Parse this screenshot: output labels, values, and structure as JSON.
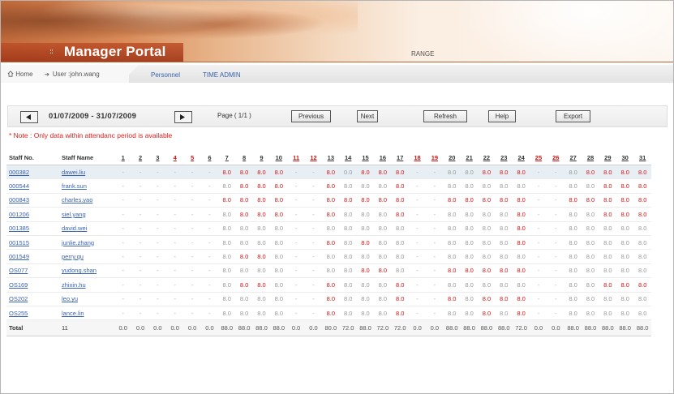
{
  "header": {
    "title": "Manager Portal",
    "range_label": "RANGE",
    "dots": "::"
  },
  "nav": {
    "home": "Home",
    "user": "User :john.wang",
    "links": [
      "Personnel",
      "TIME ADMIN"
    ]
  },
  "toolbar": {
    "prev_arrow": "◄",
    "next_arrow": "►",
    "date_range": "01/07/2009 - 31/07/2009",
    "page_info": "Page ( 1/1 )",
    "buttons": [
      "Previous",
      "Next",
      "Refresh",
      "Help",
      "Export"
    ]
  },
  "note": "* Note : Only data within attendanc period is available",
  "table": {
    "col_staff_no": "Staff No.",
    "col_staff_name": "Staff Name",
    "days": [
      "1",
      "2",
      "3",
      "4",
      "5",
      "6",
      "7",
      "8",
      "9",
      "10",
      "11",
      "12",
      "13",
      "14",
      "15",
      "16",
      "17",
      "18",
      "19",
      "20",
      "21",
      "22",
      "23",
      "24",
      "25",
      "26",
      "27",
      "28",
      "29",
      "30",
      "31"
    ],
    "weekend_days": [
      4,
      5,
      11,
      12,
      18,
      19,
      25,
      26
    ],
    "rows": [
      {
        "no": "000382",
        "name": "dawei.liu",
        "cells": [
          "-",
          "-",
          "-",
          "-",
          "-",
          "-",
          "8.0r",
          "8.0r",
          "8.0r",
          "8.0r",
          "-",
          "-",
          "8.0r",
          "0.0",
          "8.0r",
          "8.0r",
          "8.0r",
          "-",
          "-",
          "8.0",
          "8.0",
          "8.0r",
          "8.0r",
          "8.0r",
          "-",
          "-",
          "8.0",
          "8.0r",
          "8.0r",
          "8.0r",
          "8.0r"
        ]
      },
      {
        "no": "000544",
        "name": "frank.sun",
        "cells": [
          "-",
          "-",
          "-",
          "-",
          "-",
          "-",
          "8.0",
          "8.0r",
          "8.0r",
          "8.0r",
          "-",
          "-",
          "8.0r",
          "8.0",
          "8.0",
          "8.0",
          "8.0r",
          "-",
          "-",
          "8.0",
          "8.0",
          "8.0",
          "8.0",
          "8.0",
          "-",
          "-",
          "8.0",
          "8.0",
          "8.0r",
          "8.0r",
          "8.0r"
        ]
      },
      {
        "no": "000843",
        "name": "charles.yao",
        "cells": [
          "-",
          "-",
          "-",
          "-",
          "-",
          "-",
          "8.0r",
          "8.0r",
          "8.0r",
          "8.0r",
          "-",
          "-",
          "8.0r",
          "8.0r",
          "8.0r",
          "8.0r",
          "8.0r",
          "-",
          "-",
          "8.0r",
          "8.0r",
          "8.0r",
          "8.0r",
          "8.0r",
          "-",
          "-",
          "8.0r",
          "8.0r",
          "8.0r",
          "8.0r",
          "8.0r"
        ]
      },
      {
        "no": "001206",
        "name": "siel.yang",
        "cells": [
          "-",
          "-",
          "-",
          "-",
          "-",
          "-",
          "8.0",
          "8.0r",
          "8.0r",
          "8.0r",
          "-",
          "-",
          "8.0r",
          "8.0",
          "8.0",
          "8.0",
          "8.0r",
          "-",
          "-",
          "8.0",
          "8.0",
          "8.0",
          "8.0",
          "8.0r",
          "-",
          "-",
          "8.0",
          "8.0",
          "8.0r",
          "8.0r",
          "8.0r"
        ]
      },
      {
        "no": "001385",
        "name": "david.wei",
        "cells": [
          "-",
          "-",
          "-",
          "-",
          "-",
          "-",
          "8.0",
          "8.0",
          "8.0",
          "8.0",
          "-",
          "-",
          "8.0",
          "8.0",
          "8.0",
          "8.0",
          "8.0",
          "-",
          "-",
          "8.0",
          "8.0",
          "8.0",
          "8.0",
          "8.0r",
          "-",
          "-",
          "8.0",
          "8.0",
          "8.0",
          "8.0",
          "8.0"
        ]
      },
      {
        "no": "001515",
        "name": "junlie.zhang",
        "cells": [
          "-",
          "-",
          "-",
          "-",
          "-",
          "-",
          "8.0",
          "8.0",
          "8.0",
          "8.0",
          "-",
          "-",
          "8.0r",
          "8.0",
          "8.0r",
          "8.0",
          "8.0",
          "-",
          "-",
          "8.0",
          "8.0",
          "8.0",
          "8.0",
          "8.0r",
          "-",
          "-",
          "8.0",
          "8.0",
          "8.0",
          "8.0",
          "8.0"
        ]
      },
      {
        "no": "001549",
        "name": "perry.qu",
        "cells": [
          "-",
          "-",
          "-",
          "-",
          "-",
          "-",
          "8.0",
          "8.0r",
          "8.0r",
          "8.0",
          "-",
          "-",
          "8.0",
          "8.0",
          "8.0",
          "8.0",
          "8.0",
          "-",
          "-",
          "8.0",
          "8.0",
          "8.0",
          "8.0",
          "8.0",
          "-",
          "-",
          "8.0",
          "8.0",
          "8.0",
          "8.0",
          "8.0"
        ]
      },
      {
        "no": "OS077",
        "name": "yudong.shan",
        "cells": [
          "-",
          "-",
          "-",
          "-",
          "-",
          "-",
          "8.0",
          "8.0",
          "8.0",
          "8.0",
          "-",
          "-",
          "8.0",
          "8.0",
          "8.0r",
          "8.0r",
          "8.0",
          "-",
          "-",
          "8.0r",
          "8.0r",
          "8.0r",
          "8.0r",
          "8.0r",
          "-",
          "-",
          "8.0",
          "8.0",
          "8.0",
          "8.0",
          "8.0"
        ]
      },
      {
        "no": "OS169",
        "name": "zhixin.hu",
        "cells": [
          "-",
          "-",
          "-",
          "-",
          "-",
          "-",
          "8.0",
          "8.0r",
          "8.0r",
          "8.0",
          "-",
          "-",
          "8.0r",
          "8.0",
          "8.0",
          "8.0",
          "8.0r",
          "-",
          "-",
          "8.0",
          "8.0",
          "8.0",
          "8.0",
          "8.0",
          "-",
          "-",
          "8.0",
          "8.0",
          "8.0r",
          "8.0r",
          "8.0r"
        ]
      },
      {
        "no": "OS202",
        "name": "leo.yu",
        "cells": [
          "-",
          "-",
          "-",
          "-",
          "-",
          "-",
          "8.0",
          "8.0",
          "8.0",
          "8.0",
          "-",
          "-",
          "8.0r",
          "8.0",
          "8.0",
          "8.0",
          "8.0r",
          "-",
          "-",
          "8.0r",
          "8.0",
          "8.0r",
          "8.0r",
          "8.0r",
          "-",
          "-",
          "8.0",
          "8.0",
          "8.0",
          "8.0",
          "8.0"
        ]
      },
      {
        "no": "OS255",
        "name": "lance.lin",
        "cells": [
          "-",
          "-",
          "-",
          "-",
          "-",
          "-",
          "8.0",
          "8.0",
          "8.0",
          "8.0",
          "-",
          "-",
          "8.0r",
          "8.0",
          "8.0",
          "8.0",
          "8.0r",
          "-",
          "-",
          "8.0",
          "8.0",
          "8.0r",
          "8.0",
          "8.0r",
          "-",
          "-",
          "8.0",
          "8.0",
          "8.0",
          "8.0",
          "8.0"
        ]
      }
    ],
    "total_label": "Total",
    "total_count": "11",
    "totals": [
      "0.0",
      "0.0",
      "0.0",
      "0.0",
      "0.0",
      "0.0",
      "88.0",
      "88.0",
      "88.0",
      "88.0",
      "0.0",
      "0.0",
      "80.0",
      "72.0",
      "88.0",
      "72.0",
      "72.0",
      "0.0",
      "0.0",
      "88.0",
      "88.0",
      "88.0",
      "88.0",
      "72.0",
      "0.0",
      "0.0",
      "88.0",
      "88.0",
      "88.0",
      "88.0",
      "88.0"
    ]
  },
  "colors": {
    "banner_strip": "#c0602e",
    "link": "#3a63b0",
    "weekend": "#cc1111",
    "highlight_row": "#e8eff4"
  }
}
